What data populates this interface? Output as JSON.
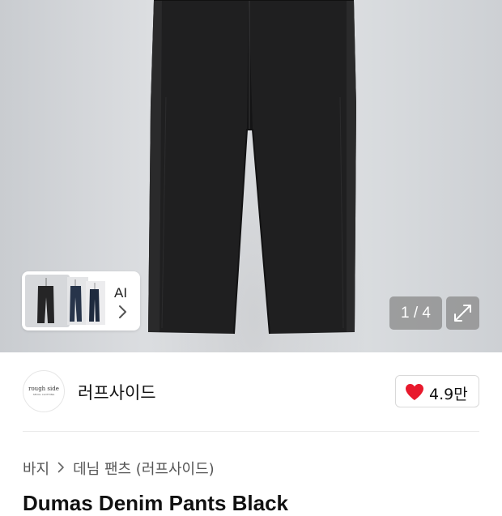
{
  "gallery": {
    "counter": "1 / 4",
    "ai_label": "AI"
  },
  "brand": {
    "logo_text": "rough side",
    "logo_sub": "SEOUL CLOTHING",
    "name": "러프사이드"
  },
  "like": {
    "count": "4.9만",
    "heart_color": "#e8192c"
  },
  "breadcrumb": {
    "level1": "바지",
    "level2": "데님 팬츠 (러프사이드)"
  },
  "product": {
    "title": "Dumas Denim Pants Black"
  }
}
